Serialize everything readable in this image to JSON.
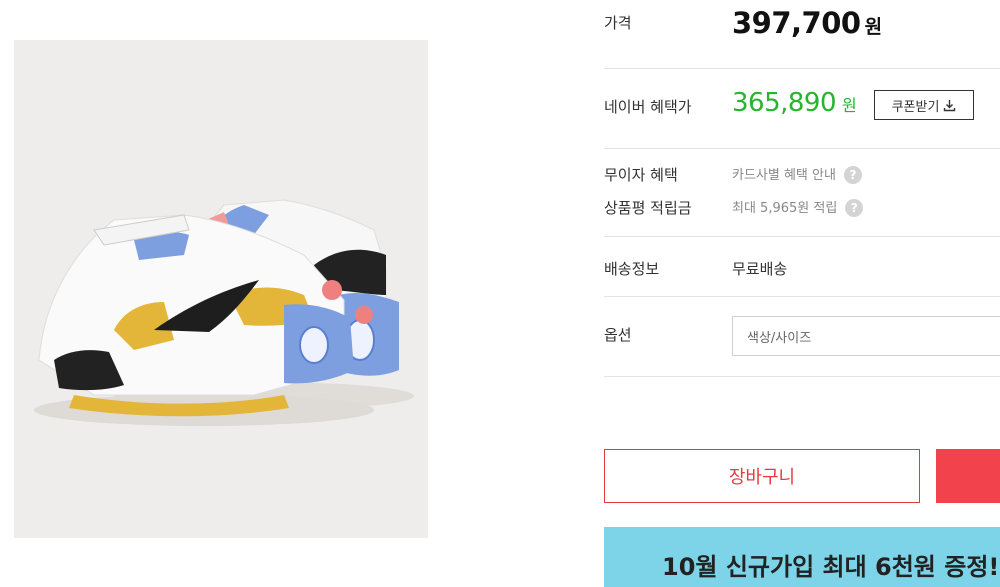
{
  "price": {
    "label": "가격",
    "value": "397,700",
    "unit": "원"
  },
  "naver_benefit": {
    "label": "네이버 혜택가",
    "value": "365,890",
    "unit": "원",
    "coupon_button": "쿠폰받기"
  },
  "interest_free": {
    "label": "무이자 혜택",
    "text": "카드사별 혜택 안내"
  },
  "review_points": {
    "label": "상품평 적립금",
    "text": "최대 5,965원 적립"
  },
  "shipping": {
    "label": "배송정보",
    "text": "무료배송"
  },
  "option": {
    "label": "옵션",
    "placeholder": "색상/사이즈"
  },
  "buttons": {
    "cart": "장바구니"
  },
  "banner": {
    "text": "10월 신규가입 최대 6천원 증정!"
  },
  "colors": {
    "green": "#26b52d",
    "red": "#e53a40",
    "banner": "#7dd4e8"
  },
  "icons": {
    "help": "?",
    "download": "download-icon"
  }
}
